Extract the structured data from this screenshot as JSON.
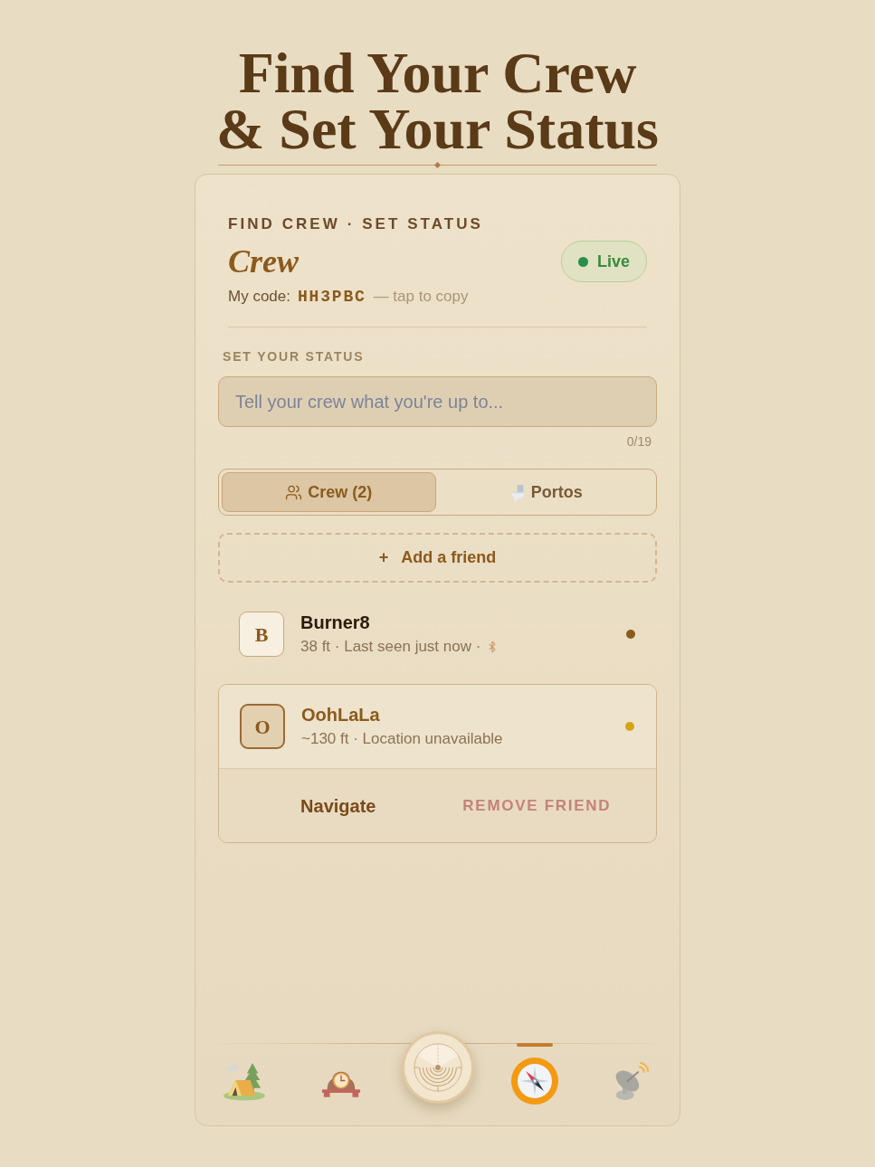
{
  "headline": {
    "lines": [
      "Find Your Crew",
      "& Set Your Status"
    ]
  },
  "header": {
    "eyebrow": "FIND CREW · SET STATUS",
    "title": "Crew",
    "live": {
      "label": "Live",
      "on": true
    },
    "code": {
      "label": "My code:",
      "value": "HH3PBC",
      "hint": "— tap to copy"
    }
  },
  "status": {
    "label": "SET YOUR STATUS",
    "placeholder": "Tell your crew what you're up to...",
    "counter": "0/19"
  },
  "tabs": [
    {
      "kind": "crew",
      "label": "Crew (2)",
      "selected": true
    },
    {
      "kind": "portos",
      "label": "Portos",
      "selected": false
    }
  ],
  "add_friend": {
    "icon": "+",
    "label": "Add a friend"
  },
  "friends": [
    {
      "initial": "B",
      "name": "Burner8",
      "detail": "38 ft · Last seen just now ·",
      "bluetooth": true,
      "color": "#8b5a1e",
      "expanded": false
    },
    {
      "initial": "O",
      "name": "OohLaLa",
      "detail": "~130 ft · Location unavailable",
      "bluetooth": false,
      "color": "#d4a418",
      "expanded": true,
      "actions": [
        {
          "kind": "navigate",
          "label": "Navigate"
        },
        {
          "kind": "remove",
          "label": "REMOVE FRIEND"
        }
      ]
    }
  ],
  "nav": [
    {
      "kind": "camp",
      "selected": false
    },
    {
      "kind": "clock",
      "selected": false
    },
    {
      "kind": "radar",
      "selected": false
    },
    {
      "kind": "compass",
      "selected": true
    },
    {
      "kind": "dish",
      "selected": false
    }
  ]
}
